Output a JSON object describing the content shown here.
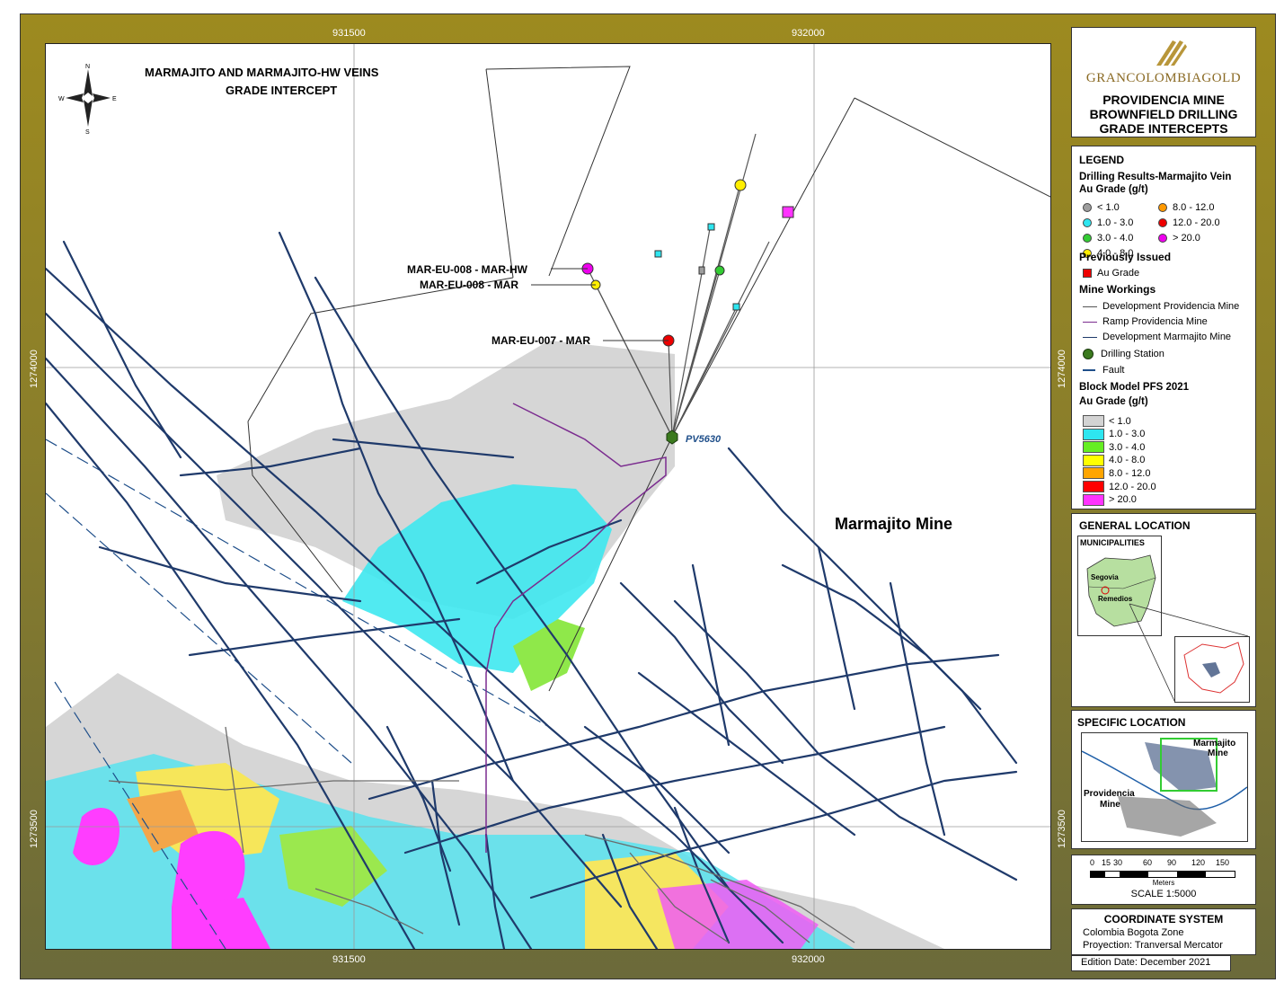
{
  "map": {
    "title_line1": "MARMAJITO AND MARMAJITO-HW VEINS",
    "title_line2": "GRADE INTERCEPT",
    "north_arrow": {
      "n": "N",
      "s": "S",
      "e": "E",
      "w": "W",
      "icon": "north-arrow-icon"
    },
    "coords": {
      "top_x1": "931500",
      "top_x2": "932000",
      "bottom_x1": "931500",
      "bottom_x2": "932000",
      "left_y1": "1274000",
      "left_y2": "1273500",
      "right_y1": "1274000",
      "right_y2": "1273500"
    },
    "labels": {
      "mar_eu_008_hw": "MAR-EU-008 - MAR-HW",
      "mar_eu_008_mar": "MAR-EU-008 - MAR",
      "mar_eu_007_mar": "MAR-EU-007 - MAR",
      "station": "PV5630",
      "mine": "Marmajito Mine"
    }
  },
  "header": {
    "logo_text": "GRANCOLOMBIAGOLD",
    "title_line1": "PROVIDENCIA MINE",
    "title_line2": "BROWNFIELD DRILLING",
    "title_line3": "GRADE INTERCEPTS"
  },
  "legend": {
    "title": "LEGEND",
    "drilling_title1": "Drilling Results-Marmajito Vein",
    "drilling_title2": "Au Grade (g/t)",
    "drilling_classes": [
      {
        "label": "< 1.0",
        "color": "#9e9e9e"
      },
      {
        "label": "1.0 - 3.0",
        "color": "#2ee6f0"
      },
      {
        "label": "3.0 - 4.0",
        "color": "#33cc33"
      },
      {
        "label": "4.0 - 8.0",
        "color": "#ffee00"
      },
      {
        "label": "8.0 - 12.0",
        "color": "#ff9900"
      },
      {
        "label": "12.0 - 20.0",
        "color": "#ee0000"
      },
      {
        "label": "> 20.0",
        "color": "#ee00ee"
      }
    ],
    "prev_title": "Previously Issued",
    "prev_item": "Au Grade",
    "workings_title": "Mine Workings",
    "workings": [
      {
        "label": "Development Providencia Mine",
        "color": "#555555"
      },
      {
        "label": "Ramp Providencia Mine",
        "color": "#7b2c8f"
      },
      {
        "label": "Development Marmajito Mine",
        "color": "#1f3a6b"
      }
    ],
    "station_label": "Drilling Station",
    "fault_label": "Fault",
    "block_title1": "Block Model PFS 2021",
    "block_title2": "Au Grade (g/t)",
    "block_classes": [
      {
        "label": "< 1.0",
        "color": "#d3d3d3"
      },
      {
        "label": "1.0 - 3.0",
        "color": "#2ee6f0"
      },
      {
        "label": "3.0 - 4.0",
        "color": "#66ee22"
      },
      {
        "label": "4.0 - 8.0",
        "color": "#ffff00"
      },
      {
        "label": "8.0 - 12.0",
        "color": "#ffa500"
      },
      {
        "label": "12.0 - 20.0",
        "color": "#ff0000"
      },
      {
        "label": "> 20.0",
        "color": "#ff33ff"
      }
    ]
  },
  "general_location": {
    "title": "GENERAL LOCATION",
    "inset_title": "MUNICIPALITIES",
    "segovia": "Segovia",
    "remedios": "Remedios"
  },
  "specific_location": {
    "title": "SPECIFIC LOCATION",
    "marmajito": "Marmajito",
    "marmajito2": "Mine",
    "providencia": "Providencia",
    "providencia2": "Mine"
  },
  "scale": {
    "ticks": [
      "0",
      "15",
      "30",
      "60",
      "90",
      "120",
      "150"
    ],
    "unit": "Meters",
    "label": "SCALE 1:5000"
  },
  "coordinate_system": {
    "title": "COORDINATE SYSTEM",
    "line1": "Colombia Bogota Zone",
    "line2": "Proyection: Tranversal Mercator",
    "edition": "Edition Date: December 2021"
  }
}
